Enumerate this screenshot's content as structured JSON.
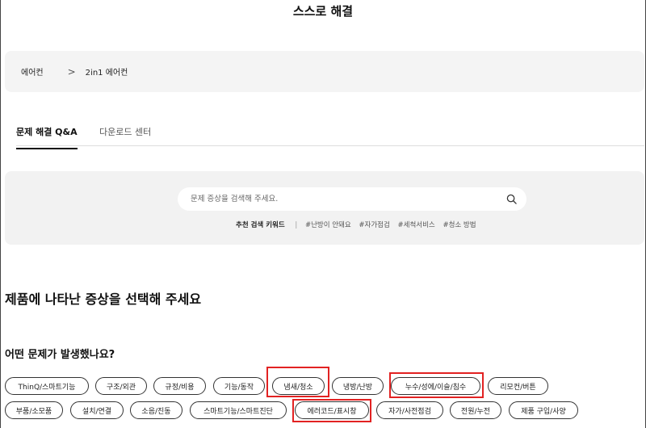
{
  "header": {
    "title": "스스로 해결"
  },
  "breadcrumb": {
    "items": [
      "에어컨",
      "2in1 에어컨"
    ],
    "separator": ">"
  },
  "tabs": [
    {
      "label": "문제 해결 Q&A",
      "active": true
    },
    {
      "label": "다운로드 센터",
      "active": false
    }
  ],
  "search": {
    "placeholder": "문제 증상을 검색해 주세요.",
    "value": "",
    "keywords_label": "추천 검색 키워드",
    "keywords": [
      "#난방이 안돼요",
      "#자가점검",
      "#세척서비스",
      "#청소 방법"
    ]
  },
  "main": {
    "heading": "제품에 나타난 증상을 선택해 주세요",
    "subheading": "어떤 문제가 발생했나요?"
  },
  "categories": [
    "ThinQ/스마트기능",
    "구조/외관",
    "규정/비용",
    "기능/동작",
    "냄새/청소",
    "냉방/난방",
    "누수/성에/이슬/침수",
    "리모컨/버튼",
    "부품/소모품",
    "설치/연결",
    "소음/진동",
    "스마트기능/스마트진단",
    "에러코드/표시창",
    "자가/사전점검",
    "전원/누전",
    "제품 구입/사양"
  ],
  "highlight_color": "#e22222"
}
